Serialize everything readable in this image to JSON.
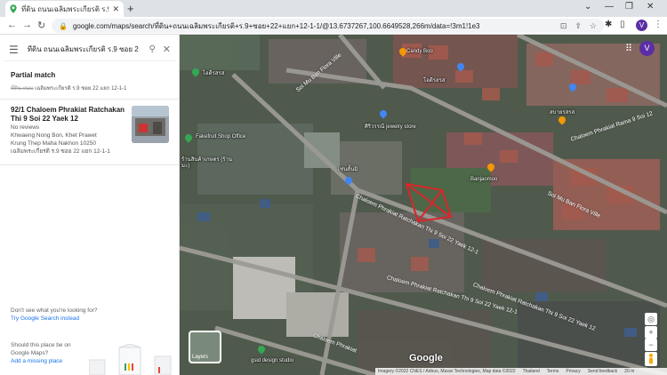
{
  "browser": {
    "tab_title": "ที่ดิน ถนนเฉลิมพระเกียรติ ร.9 ซอย 22",
    "url": "google.com/maps/search/ที่ดิน+ถนนเฉลิมพระเกียรติ+ร.9+ซอย+22+แยก+12-1-1/@13.6737267,100.6649528,266m/data=!3m1!1e3",
    "avatar_letter": "V"
  },
  "sidebar": {
    "search_value": "ที่ดิน ถนนเฉลิมพระเกียรติ ร.9 ซอย 2",
    "partial_match_heading": "Partial match",
    "partial_struck": "ที่ดิน ถนน",
    "partial_rest": "เฉลิมพระเกียรติ ร.9 ซอย 22 แยก 12-1-1",
    "result": {
      "title": "92/1 Chaloem Phrakiat Ratchakan Thi 9 Soi 22 Yaek 12",
      "reviews": "No reviews",
      "address_line1": "Khwaeng Nong Bon, Khet Prawet",
      "address_line2": "Krung Thep Maha Nakhon 10250",
      "address_line3": "เฉลิมพระเกียรติ ร.9 ซอย 22 แยก 12-1-1"
    },
    "not_found_text": "Don't see what you're looking for?",
    "not_found_link": "Try Google Search instead",
    "add_place_text1": "Should this place be on",
    "add_place_text2": "Google Maps?",
    "add_place_link": "Add a missing place"
  },
  "map": {
    "labels": [
      "ไอดีรสรส",
      "Soi Mu Ban Flora Ville",
      "Candy Boo",
      "โอดีรสรส",
      "Fakefruit Shop Office",
      "ร้านสินค้าเกษตร (ร้านมะ)",
      "เช่นตั้นมิ",
      "Banjaomoo",
      "Soi Mu Ban Flora Ville",
      "Chaloem Phrakiat Ratchakan Thi 9 Soi 22 Yaek 12-1",
      "Chaloem Phrakiat Ratchakan Thi 9 Soi 22 Yaek 12-1",
      "Chaloem Phrakiat Rama 9 Soi 12",
      "Chaloem Phrakiat",
      "gsid design studio",
      "Chaloem Phrakiat Ratchakan Thi 9 Soi 22 Yaek 12",
      "ศิริวรรณี jewelry store",
      "สบายรสรส"
    ],
    "layers_label": "Layers",
    "google_logo": "Google",
    "attribution": [
      "Imagery ©2022 CNES / Airbus, Maxar Technologies, Map data ©2022",
      "Thailand",
      "Terms",
      "Privacy",
      "Send feedback",
      "20 m"
    ]
  }
}
